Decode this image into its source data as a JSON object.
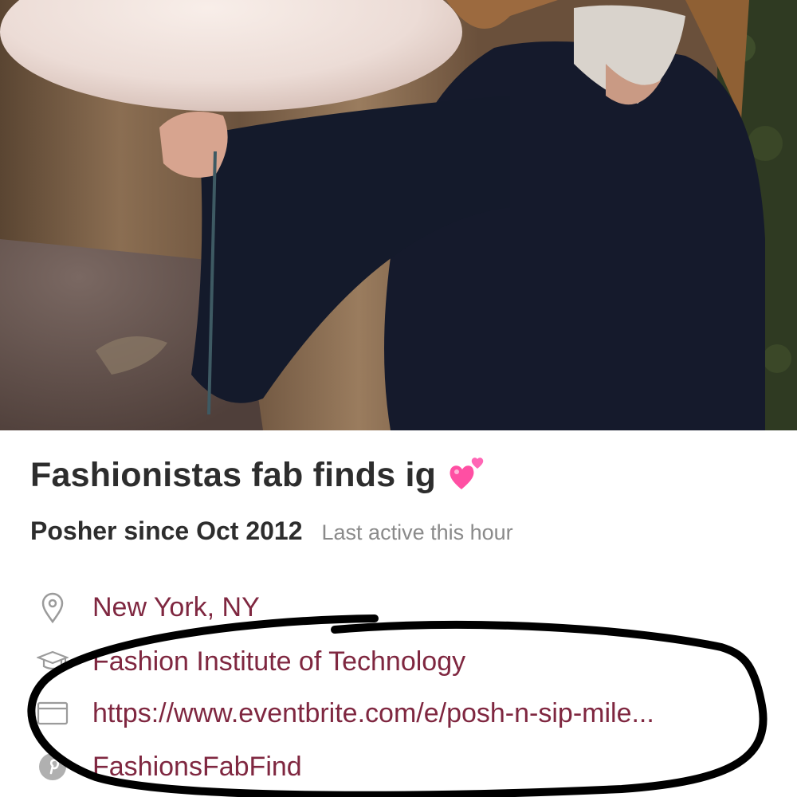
{
  "profile": {
    "name": "Fashionistas fab finds ig",
    "since": "Posher since Oct 2012",
    "last_active": "Last active this hour",
    "location": "New York, NY",
    "school": "Fashion Institute of Technology",
    "website": "https://www.eventbrite.com/e/posh-n-sip-mile...",
    "pinterest": "FashionsFabFind"
  },
  "icons": {
    "heart": "two-hearts-icon",
    "location": "location-pin-icon",
    "school": "graduation-cap-icon",
    "website": "browser-window-icon",
    "pinterest": "pinterest-icon"
  },
  "colors": {
    "title": "#2d2d2d",
    "detail_text": "#7f2740",
    "muted": "#8a8a8a",
    "icon": "#9b9b9b",
    "heart": "#ff4fa3"
  }
}
